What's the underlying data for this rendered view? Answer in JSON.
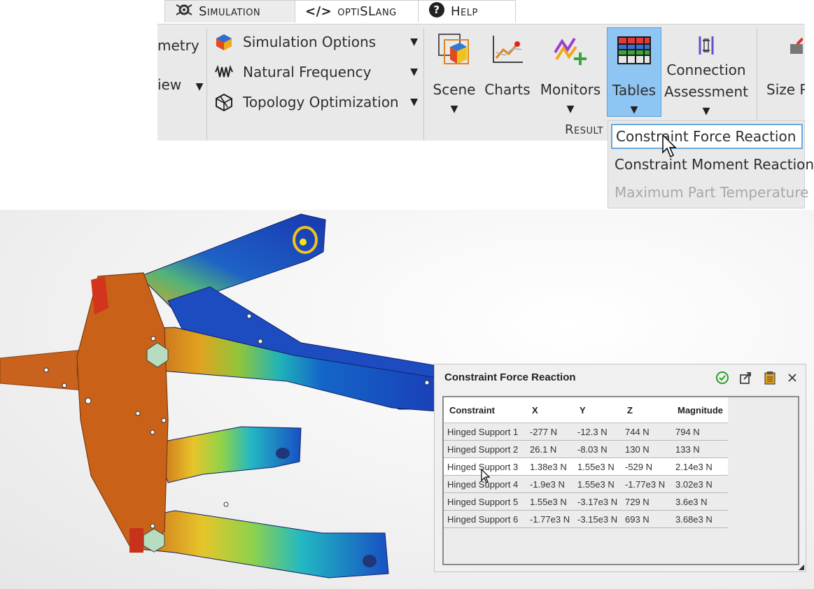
{
  "tabs": [
    {
      "label": "Simulation",
      "active": true,
      "icon": "simulation-gear-icon"
    },
    {
      "label": "optiSLang",
      "active": false,
      "icon": "code-brackets-icon"
    },
    {
      "label": "Help",
      "active": false,
      "icon": "help-circle-icon"
    }
  ],
  "left_group": {
    "item1": "metry",
    "item2": "iew"
  },
  "sim_menu": {
    "items": [
      {
        "label": "Simulation Options",
        "icon": "simulation-options-icon"
      },
      {
        "label": "Natural Frequency",
        "icon": "natural-frequency-icon"
      },
      {
        "label": "Topology Optimization",
        "icon": "topology-optimization-icon"
      }
    ]
  },
  "results_group": {
    "label": "Result",
    "buttons": {
      "scene": "Scene",
      "charts": "Charts",
      "monitors": "Monitors",
      "tables": "Tables",
      "connection_line1": "Connection",
      "connection_line2": "Assessment",
      "size": "Size P"
    }
  },
  "tables_dropdown": {
    "items": [
      {
        "label": "Constraint Force Reaction",
        "state": "hover"
      },
      {
        "label": "Constraint Moment Reaction",
        "state": "normal"
      },
      {
        "label": "Maximum Part Temperature",
        "state": "disabled"
      }
    ]
  },
  "panel": {
    "title": "Constraint Force Reaction",
    "columns": [
      "Constraint",
      "X",
      "Y",
      "Z",
      "Magnitude"
    ],
    "rows": [
      [
        "Hinged Support 1",
        "-277 N",
        "-12.3 N",
        "744 N",
        "794 N"
      ],
      [
        "Hinged Support 2",
        "26.1 N",
        "-8.03 N",
        "130 N",
        "133 N"
      ],
      [
        "Hinged Support 3",
        "1.38e3 N",
        "1.55e3 N",
        "-529 N",
        "2.14e3 N"
      ],
      [
        "Hinged Support 4",
        "-1.9e3 N",
        "1.55e3 N",
        "-1.77e3 N",
        "3.02e3 N"
      ],
      [
        "Hinged Support 5",
        "1.55e3 N",
        "-3.17e3 N",
        "729 N",
        "3.6e3 N"
      ],
      [
        "Hinged Support 6",
        "-1.77e3 N",
        "-3.15e3 N",
        "693 N",
        "3.68e3 N"
      ]
    ],
    "highlighted_row": 2
  },
  "colors": {
    "accent": "#8ec5f2",
    "ribbon_bg": "#e9e9e9",
    "ok_green": "#2aa02a"
  }
}
